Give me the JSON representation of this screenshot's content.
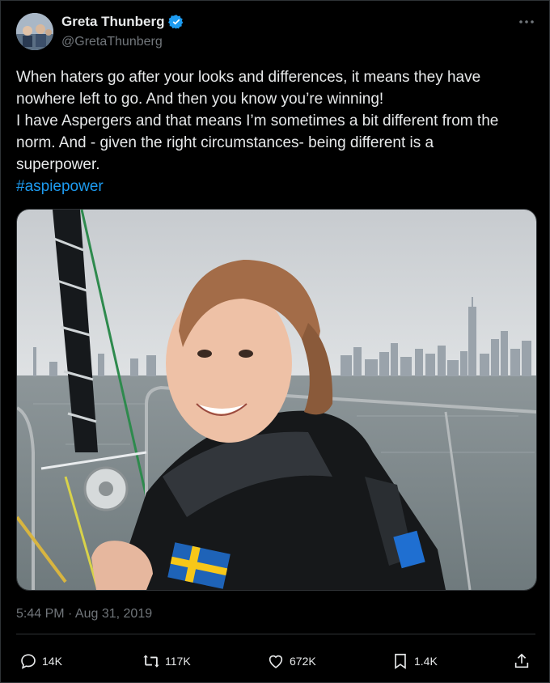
{
  "author": {
    "display_name": "Greta Thunberg",
    "handle": "@GretaThunberg",
    "verified": true,
    "avatar_icon": "profile-photo"
  },
  "tweet": {
    "lines": [
      "When haters go after your looks and differences, it means they have",
      "nowhere left to go. And then you know you’re winning!",
      "I have Aspergers and that means I’m sometimes a bit different from the",
      "norm. And - given the right circumstances- being different is a",
      "superpower."
    ],
    "hashtag": "#aspiepower",
    "timestamp": "5:44 PM · Aug 31, 2019"
  },
  "media": {
    "description_icon": "photo"
  },
  "actions": {
    "replies": "14K",
    "reposts": "117K",
    "likes": "672K",
    "bookmarks": "1.4K"
  },
  "colors": {
    "background": "#000000",
    "text": "#e7e9ea",
    "secondary": "#71767b",
    "accent": "#1d9bf0",
    "border": "#2f3336"
  }
}
